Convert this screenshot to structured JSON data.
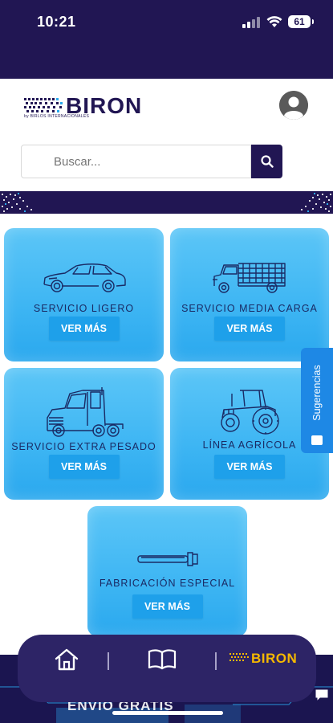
{
  "status_bar": {
    "time": "10:21",
    "battery": "61"
  },
  "header": {
    "logo_text": "BIRON",
    "logo_sub": "by BIRLOS INTERNACIONALES"
  },
  "search": {
    "placeholder": "Buscar..."
  },
  "services": [
    {
      "title": "SERVICIO LIGERO",
      "button": "VER MÁS",
      "icon": "sedan-car-icon"
    },
    {
      "title": "SERVICIO MEDIA CARGA",
      "button": "VER MÁS",
      "icon": "cargo-truck-icon"
    },
    {
      "title": "SERVICIO EXTRA PESADO",
      "button": "VER MÁS",
      "icon": "semi-truck-icon"
    },
    {
      "title": "LÍNEA AGRÍCOLA",
      "button": "VER MÁS",
      "icon": "tractor-icon"
    },
    {
      "title": "FABRICACIÓN ESPECIAL",
      "button": "VER MÁS",
      "icon": "pin-bolt-icon"
    }
  ],
  "sidebar_tab": {
    "label": "Sugerencias"
  },
  "bottom_nav": {
    "brand": "BIRON"
  },
  "bottom_banner": {
    "text": "ENVIO GRATIS"
  },
  "colors": {
    "primary": "#211653",
    "card": "#3db5f3",
    "button": "#1ea0ea",
    "tab": "#1e88e5"
  }
}
